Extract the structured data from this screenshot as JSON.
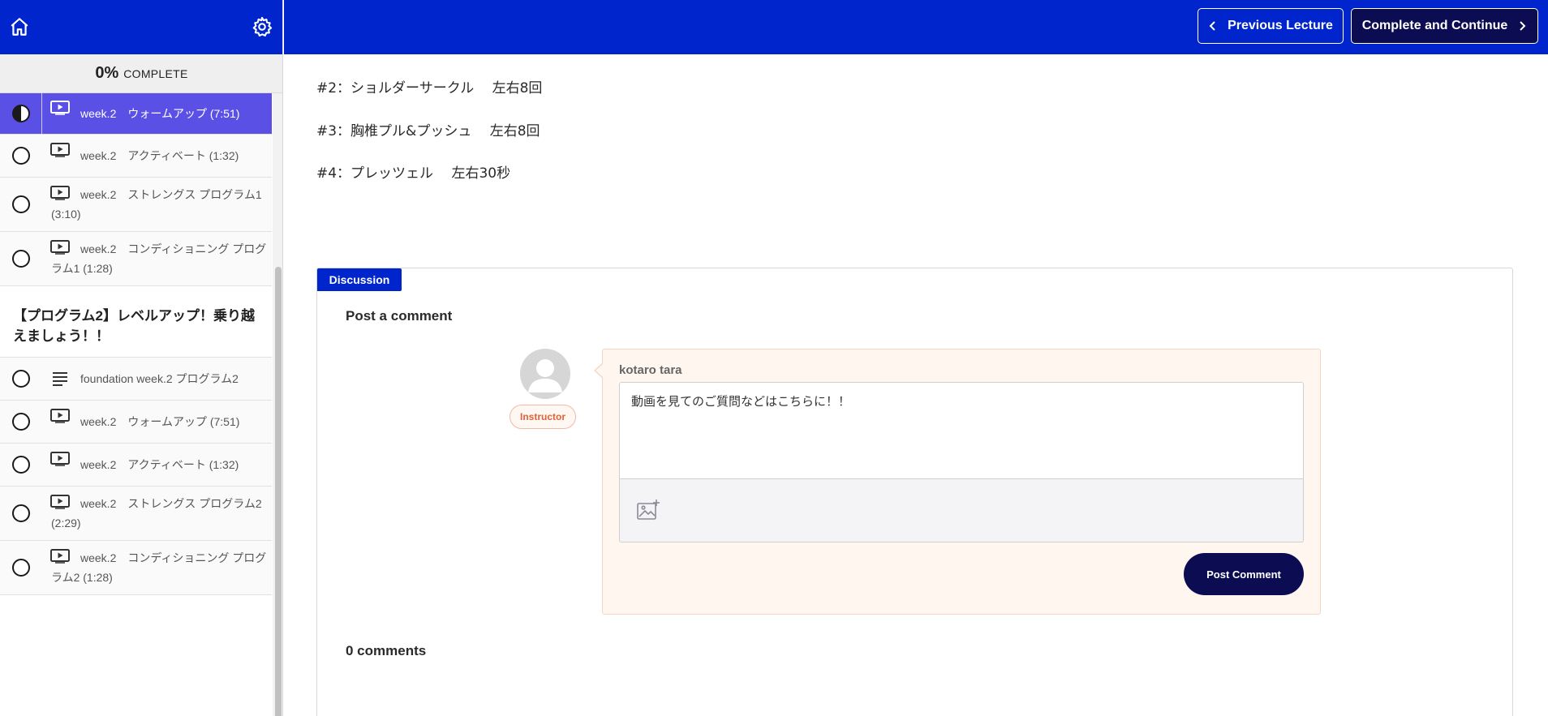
{
  "colors": {
    "brand_blue": "#0025cc",
    "dark_navy": "#0c0c52",
    "active_lecture": "#5b50e6",
    "instructor_orange": "#e0623a"
  },
  "header": {
    "home_icon": "home-icon",
    "settings_icon": "gear-icon"
  },
  "progress": {
    "percent_text": "0%",
    "label": "COMPLETE",
    "value": 0
  },
  "sidebar": {
    "lectures_a": [
      {
        "title": "week.2　ウォームアップ (7:51)",
        "icon": "video-icon",
        "active": true
      },
      {
        "title": "week.2　アクティベート (1:32)",
        "icon": "video-icon",
        "active": false
      },
      {
        "title": "week.2　ストレングス プログラム1 (3:10)",
        "icon": "video-icon",
        "active": false
      },
      {
        "title": "week.2　コンディショニング プログラム1 (1:28)",
        "icon": "video-icon",
        "active": false
      }
    ],
    "section_title": "【プログラム2】レベルアップ！乗り越えましょう！！",
    "lectures_b": [
      {
        "title": "foundation week.2 プログラム2",
        "icon": "text-lines-icon",
        "active": false
      },
      {
        "title": "week.2　ウォームアップ (7:51)",
        "icon": "video-icon",
        "active": false
      },
      {
        "title": "week.2　アクティベート (1:32)",
        "icon": "video-icon",
        "active": false
      },
      {
        "title": "week.2　ストレングス プログラム2 (2:29)",
        "icon": "video-icon",
        "active": false
      },
      {
        "title": "week.2　コンディショニング プログラム2 (1:28)",
        "icon": "video-icon",
        "active": false
      }
    ]
  },
  "topbar": {
    "prev_label": "Previous Lecture",
    "next_label": "Complete and Continue"
  },
  "content": {
    "lines": [
      "#2：ショルダーサークル　 左右8回",
      "#3：胸椎プル&プッシュ　 左右8回",
      "#4：プレッツェル　 左右30秒"
    ]
  },
  "discussion": {
    "tab_label": "Discussion",
    "heading": "Post a comment",
    "role_badge": "Instructor",
    "author_name": "kotaro tara",
    "comment_value": "動画を見てのご質問などはこちらに！！",
    "post_button": "Post Comment",
    "comments_count": "0 comments",
    "image_icon": "image-add-icon",
    "avatar_icon": "avatar-icon"
  }
}
